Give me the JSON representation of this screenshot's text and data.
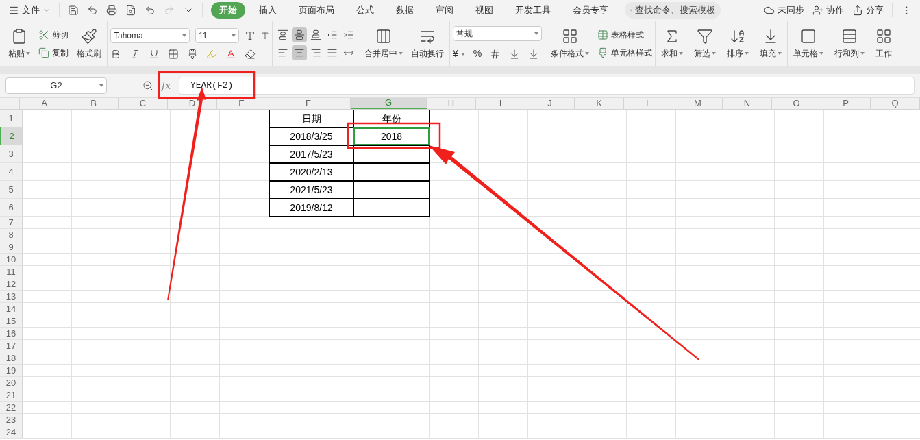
{
  "menu": {
    "label": "文件"
  },
  "tabs": [
    {
      "label": "开始",
      "selected": true
    },
    {
      "label": "插入",
      "selected": false
    },
    {
      "label": "页面布局",
      "selected": false
    },
    {
      "label": "公式",
      "selected": false
    },
    {
      "label": "数据",
      "selected": false
    },
    {
      "label": "审阅",
      "selected": false
    },
    {
      "label": "视图",
      "selected": false
    },
    {
      "label": "开发工具",
      "selected": false
    },
    {
      "label": "会员专享",
      "selected": false
    }
  ],
  "search": {
    "placeholder": "查找命令、搜索模板"
  },
  "top_actions": [
    "未同步",
    "协作",
    "分享"
  ],
  "ribbon": {
    "paste": "粘贴",
    "cut": "剪切",
    "copy": "复制",
    "format_painter": "格式刷",
    "font_name": "Tahoma",
    "font_size": "11",
    "align_buttons": [
      {
        "kind": "top",
        "selected": false
      },
      {
        "kind": "middle",
        "selected": true
      },
      {
        "kind": "bottom",
        "selected": false
      },
      {
        "kind": "outdent",
        "selected": false
      },
      {
        "kind": "indent",
        "selected": false
      },
      {
        "kind": "left",
        "selected": false
      },
      {
        "kind": "center",
        "selected": true
      },
      {
        "kind": "right",
        "selected": false
      },
      {
        "kind": "justify",
        "selected": false
      },
      {
        "kind": "distribute",
        "selected": false
      }
    ],
    "merge": "合并居中",
    "wrap": "自动换行",
    "number_format": "常规",
    "currency": "¥",
    "percent": "%",
    "conditional_format": "条件格式",
    "table_style": "表格样式",
    "cell_style": "单元格样式",
    "sum": "求和",
    "filter": "筛选",
    "sort": "排序",
    "fill": "填充",
    "cells": "单元格",
    "rows_cols": "行和列",
    "worksheet": "工作"
  },
  "formula_bar": {
    "name_box": "G2",
    "fx": "fx",
    "formula": "=YEAR(F2)"
  },
  "sheet": {
    "columns": [
      {
        "label": "A",
        "selected": false
      },
      {
        "label": "B",
        "selected": false
      },
      {
        "label": "C",
        "selected": false
      },
      {
        "label": "D",
        "selected": false
      },
      {
        "label": "E",
        "selected": false
      },
      {
        "label": "F",
        "selected": false
      },
      {
        "label": "G",
        "selected": true
      },
      {
        "label": "H",
        "selected": false
      },
      {
        "label": "I",
        "selected": false
      },
      {
        "label": "J",
        "selected": false
      },
      {
        "label": "K",
        "selected": false
      },
      {
        "label": "L",
        "selected": false
      },
      {
        "label": "M",
        "selected": false
      },
      {
        "label": "N",
        "selected": false
      },
      {
        "label": "O",
        "selected": false
      },
      {
        "label": "P",
        "selected": false
      },
      {
        "label": "Q",
        "selected": false
      }
    ],
    "rows": [
      {
        "label": "1",
        "selected": false,
        "cells": [
          {},
          {},
          {},
          {},
          {},
          {
            "text": "日期",
            "bordered": true
          },
          {
            "text": "年份",
            "bordered": true
          }
        ]
      },
      {
        "label": "2",
        "selected": true,
        "cells": [
          {},
          {},
          {},
          {},
          {},
          {
            "text": "2018/3/25",
            "bordered": true
          },
          {
            "text": "2018",
            "bordered": true,
            "selected": true
          }
        ]
      },
      {
        "label": "3",
        "selected": false,
        "cells": [
          {},
          {},
          {},
          {},
          {},
          {
            "text": "2017/5/23",
            "bordered": true
          },
          {
            "bordered": true
          }
        ]
      },
      {
        "label": "4",
        "selected": false,
        "cells": [
          {},
          {},
          {},
          {},
          {},
          {
            "text": "2020/2/13",
            "bordered": true
          },
          {
            "bordered": true
          }
        ]
      },
      {
        "label": "5",
        "selected": false,
        "cells": [
          {},
          {},
          {},
          {},
          {},
          {
            "text": "2021/5/23",
            "bordered": true
          },
          {
            "bordered": true
          }
        ]
      },
      {
        "label": "6",
        "selected": false,
        "cells": [
          {},
          {},
          {},
          {},
          {},
          {
            "text": "2019/8/12",
            "bordered": true
          },
          {
            "bordered": true
          }
        ]
      },
      {
        "label": "7",
        "selected": false
      },
      {
        "label": "8",
        "selected": false
      },
      {
        "label": "9",
        "selected": false
      },
      {
        "label": "10",
        "selected": false
      },
      {
        "label": "11",
        "selected": false
      },
      {
        "label": "12",
        "selected": false
      },
      {
        "label": "13",
        "selected": false
      },
      {
        "label": "14",
        "selected": false
      },
      {
        "label": "15",
        "selected": false
      },
      {
        "label": "16",
        "selected": false
      },
      {
        "label": "17",
        "selected": false
      },
      {
        "label": "18",
        "selected": false
      },
      {
        "label": "19",
        "selected": false
      },
      {
        "label": "20",
        "selected": false
      },
      {
        "label": "21",
        "selected": false
      },
      {
        "label": "22",
        "selected": false
      },
      {
        "label": "23",
        "selected": false
      },
      {
        "label": "24",
        "selected": false
      }
    ]
  }
}
